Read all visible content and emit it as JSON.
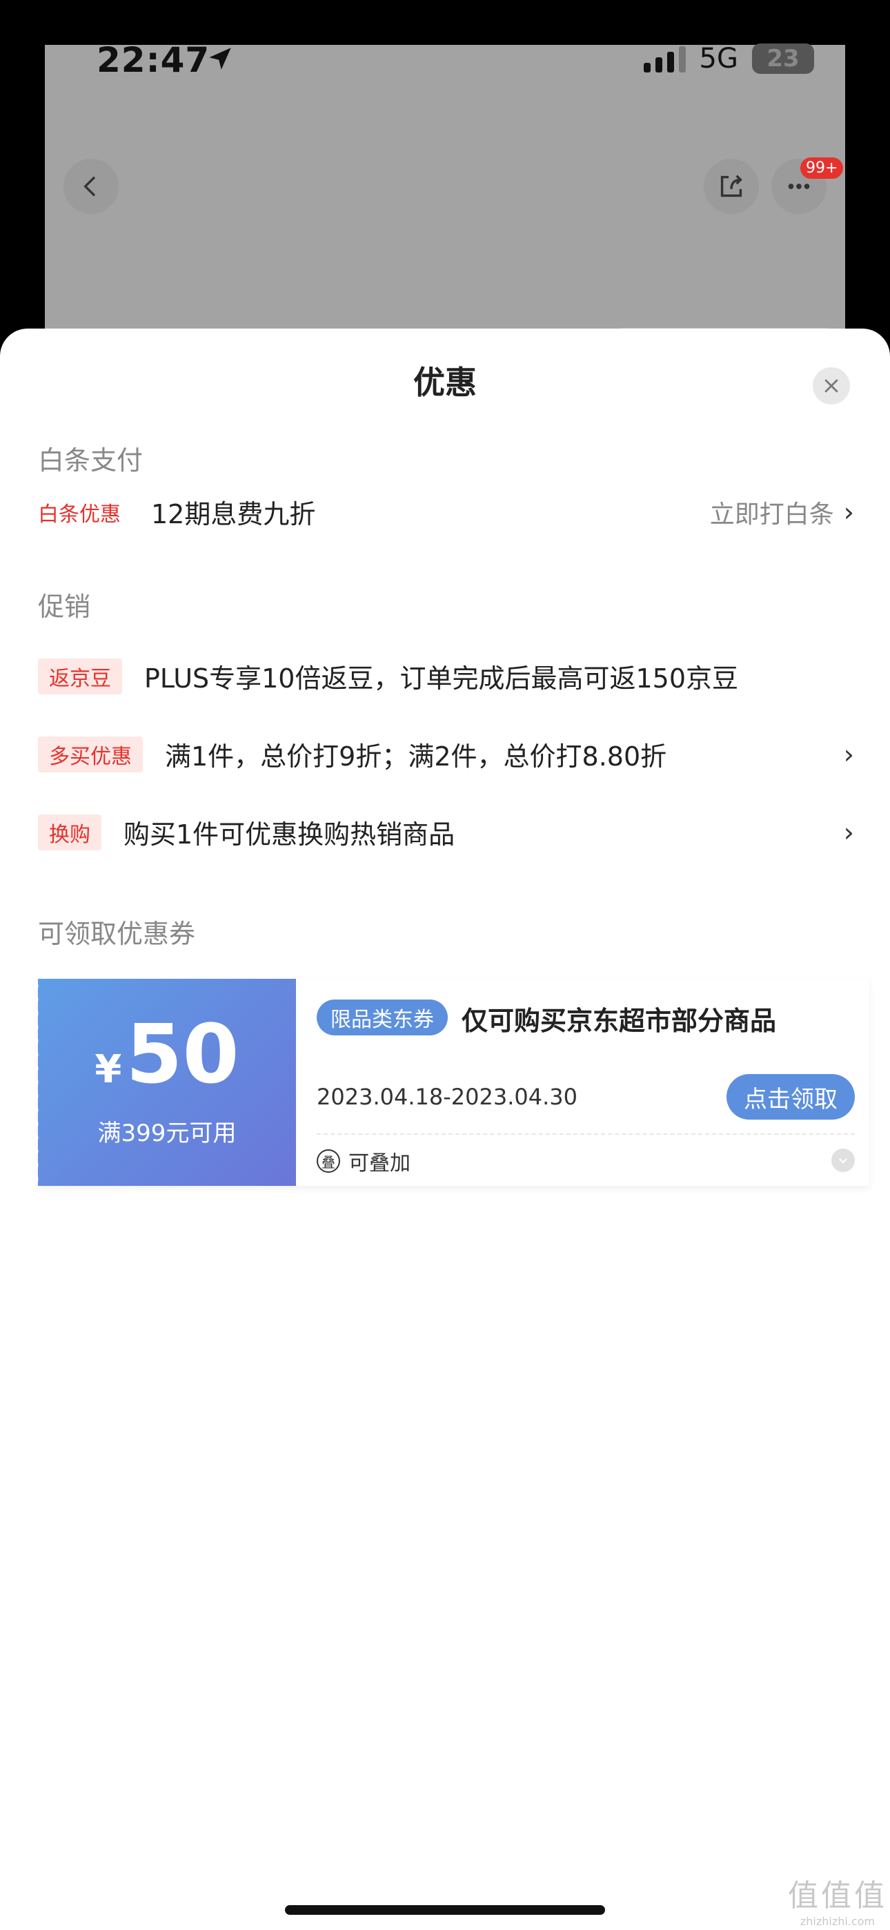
{
  "status_bar": {
    "time": "22:47",
    "network": "5G",
    "battery": "23"
  },
  "background_page": {
    "badge": "99+"
  },
  "sheet": {
    "title": "优惠",
    "baitiao": {
      "header": "白条支付",
      "tag": "白条优惠",
      "text": "12期息费九折",
      "action": "立即打白条"
    },
    "promo": {
      "header": "促销",
      "items": [
        {
          "tag": "返京豆",
          "text": "PLUS专享10倍返豆，订单完成后最高可返150京豆"
        },
        {
          "tag": "多买优惠",
          "text": "满1件，总价打9折；满2件，总价打8.80折"
        },
        {
          "tag": "换购",
          "text": "购买1件可优惠换购热销商品"
        }
      ]
    },
    "coupons": {
      "header": "可领取优惠券",
      "items": [
        {
          "currency": "¥",
          "amount": "50",
          "condition": "满399元可用",
          "tag": "限品类东券",
          "title": "仅可购买京东超市部分商品",
          "date_range": "2023.04.18-2023.04.30",
          "button": "点击领取",
          "stackable": "可叠加",
          "stack_icon": "叠"
        }
      ]
    }
  },
  "watermark": {
    "logo": "值值值",
    "url": "zhizhizhi.com"
  },
  "colors": {
    "accent_red": "#e5322d",
    "coupon_blue": "#5c8fde",
    "sheet_bg": "#ffffff"
  }
}
